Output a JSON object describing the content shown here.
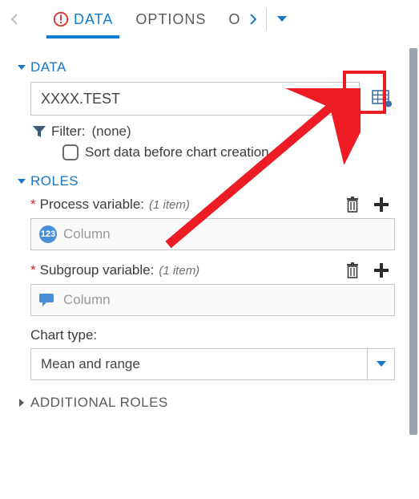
{
  "tabs": {
    "data": "DATA",
    "options": "OPTIONS",
    "overflow_fragment": "O"
  },
  "sections": {
    "data": "DATA",
    "roles": "ROLES",
    "additional": "ADDITIONAL ROLES"
  },
  "data_source": {
    "value": "XXXX.TEST"
  },
  "filter": {
    "label": "Filter:",
    "value": "(none)"
  },
  "sort": {
    "checkbox_label": "Sort data before chart creation"
  },
  "roles": {
    "process": {
      "label": "Process variable:",
      "count": "(1 item)",
      "placeholder": "Column",
      "numeric_badge": "123"
    },
    "subgroup": {
      "label": "Subgroup variable:",
      "count": "(1 item)",
      "placeholder": "Column"
    },
    "chart_type": {
      "label": "Chart type:",
      "value": "Mean and range"
    }
  }
}
